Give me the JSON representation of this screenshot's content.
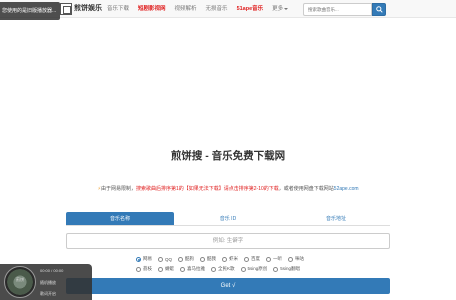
{
  "toast": {
    "text": "您使用的是旧版播放器..."
  },
  "brand": {
    "name": "煎饼娱乐"
  },
  "nav": {
    "items": [
      {
        "label": "音乐下载",
        "red": false
      },
      {
        "label": "短剧影视网",
        "red": true
      },
      {
        "label": "视频解析",
        "red": false
      },
      {
        "label": "无损音乐",
        "red": false
      },
      {
        "label": "51ape音乐",
        "red": true
      },
      {
        "label": "更多",
        "red": false
      }
    ]
  },
  "search": {
    "placeholder": "搜索歌曲音乐..."
  },
  "main": {
    "title": "煎饼搜 - 音乐免费下载网",
    "notice": {
      "part1": "由于网易限制，",
      "part2": "搜索歌曲后排序第1的【如果无法下载】请点击排序第2-10的下载",
      "part3": "，或者使用网盘下载网站",
      "link": "52ape.com"
    },
    "tabs": [
      "音乐名称",
      "音乐 ID",
      "音乐地址"
    ],
    "input_placeholder": "例如: 生僻字",
    "sources_row1": [
      "网易",
      "QQ",
      "酷狗",
      "酷我",
      "虾米",
      "百度",
      "一听",
      "咪咕"
    ],
    "sources_row2": [
      "荔枝",
      "蜻蜓",
      "喜马拉雅",
      "全民K歌",
      "5sing原创",
      "5sing翻唱"
    ],
    "selected_source": "网易",
    "get_label": "Get √"
  },
  "player": {
    "time": "00:00 / 00:00",
    "line1": "随机播放",
    "line2": "歌词开启",
    "disc_label": "煎饼"
  }
}
